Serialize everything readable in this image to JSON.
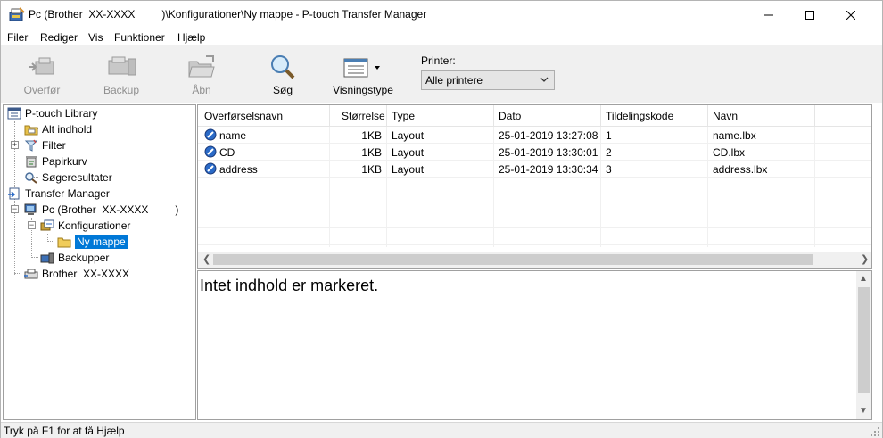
{
  "window": {
    "title": "Pc (Brother  XX-XXXX         )\\Konfigurationer\\Ny mappe - P-touch Transfer Manager"
  },
  "menu": {
    "items": [
      {
        "label": "Filer"
      },
      {
        "label": "Rediger"
      },
      {
        "label": "Vis"
      },
      {
        "label": "Funktioner"
      },
      {
        "label": "Hjælp"
      }
    ]
  },
  "toolbar": {
    "transfer_label": "Overfør",
    "backup_label": "Backup",
    "open_label": "Åbn",
    "search_label": "Søg",
    "viewtype_label": "Visningstype",
    "printer_label": "Printer:",
    "printer_value": "Alle printere"
  },
  "tree": {
    "library": "P-touch Library",
    "all_content": "Alt indhold",
    "filter": "Filter",
    "trash": "Papirkurv",
    "search_results": "Søgeresultater",
    "transfer_manager": "Transfer Manager",
    "pc": "Pc (Brother  XX-XXXX         )",
    "configurations": "Konfigurationer",
    "new_folder": "Ny mappe",
    "backups": "Backupper",
    "brother": "Brother  XX-XXXX"
  },
  "list": {
    "columns": [
      "Overførselsnavn",
      "Størrelse",
      "Type",
      "Dato",
      "Tildelingskode",
      "Navn"
    ],
    "rows": [
      {
        "name": "name",
        "size": "1KB",
        "type": "Layout",
        "date": "25-01-2019 13:27:08",
        "code": "1",
        "file": "name.lbx"
      },
      {
        "name": "CD",
        "size": "1KB",
        "type": "Layout",
        "date": "25-01-2019 13:30:01",
        "code": "2",
        "file": "CD.lbx"
      },
      {
        "name": "address",
        "size": "1KB",
        "type": "Layout",
        "date": "25-01-2019 13:30:34",
        "code": "3",
        "file": "address.lbx"
      }
    ]
  },
  "preview": {
    "text": "Intet indhold er markeret."
  },
  "status": {
    "text": "Tryk på F1 for at få Hjælp"
  },
  "colors": {
    "selection": "#0078d7",
    "toolbar_bg": "#f0f0f0"
  }
}
